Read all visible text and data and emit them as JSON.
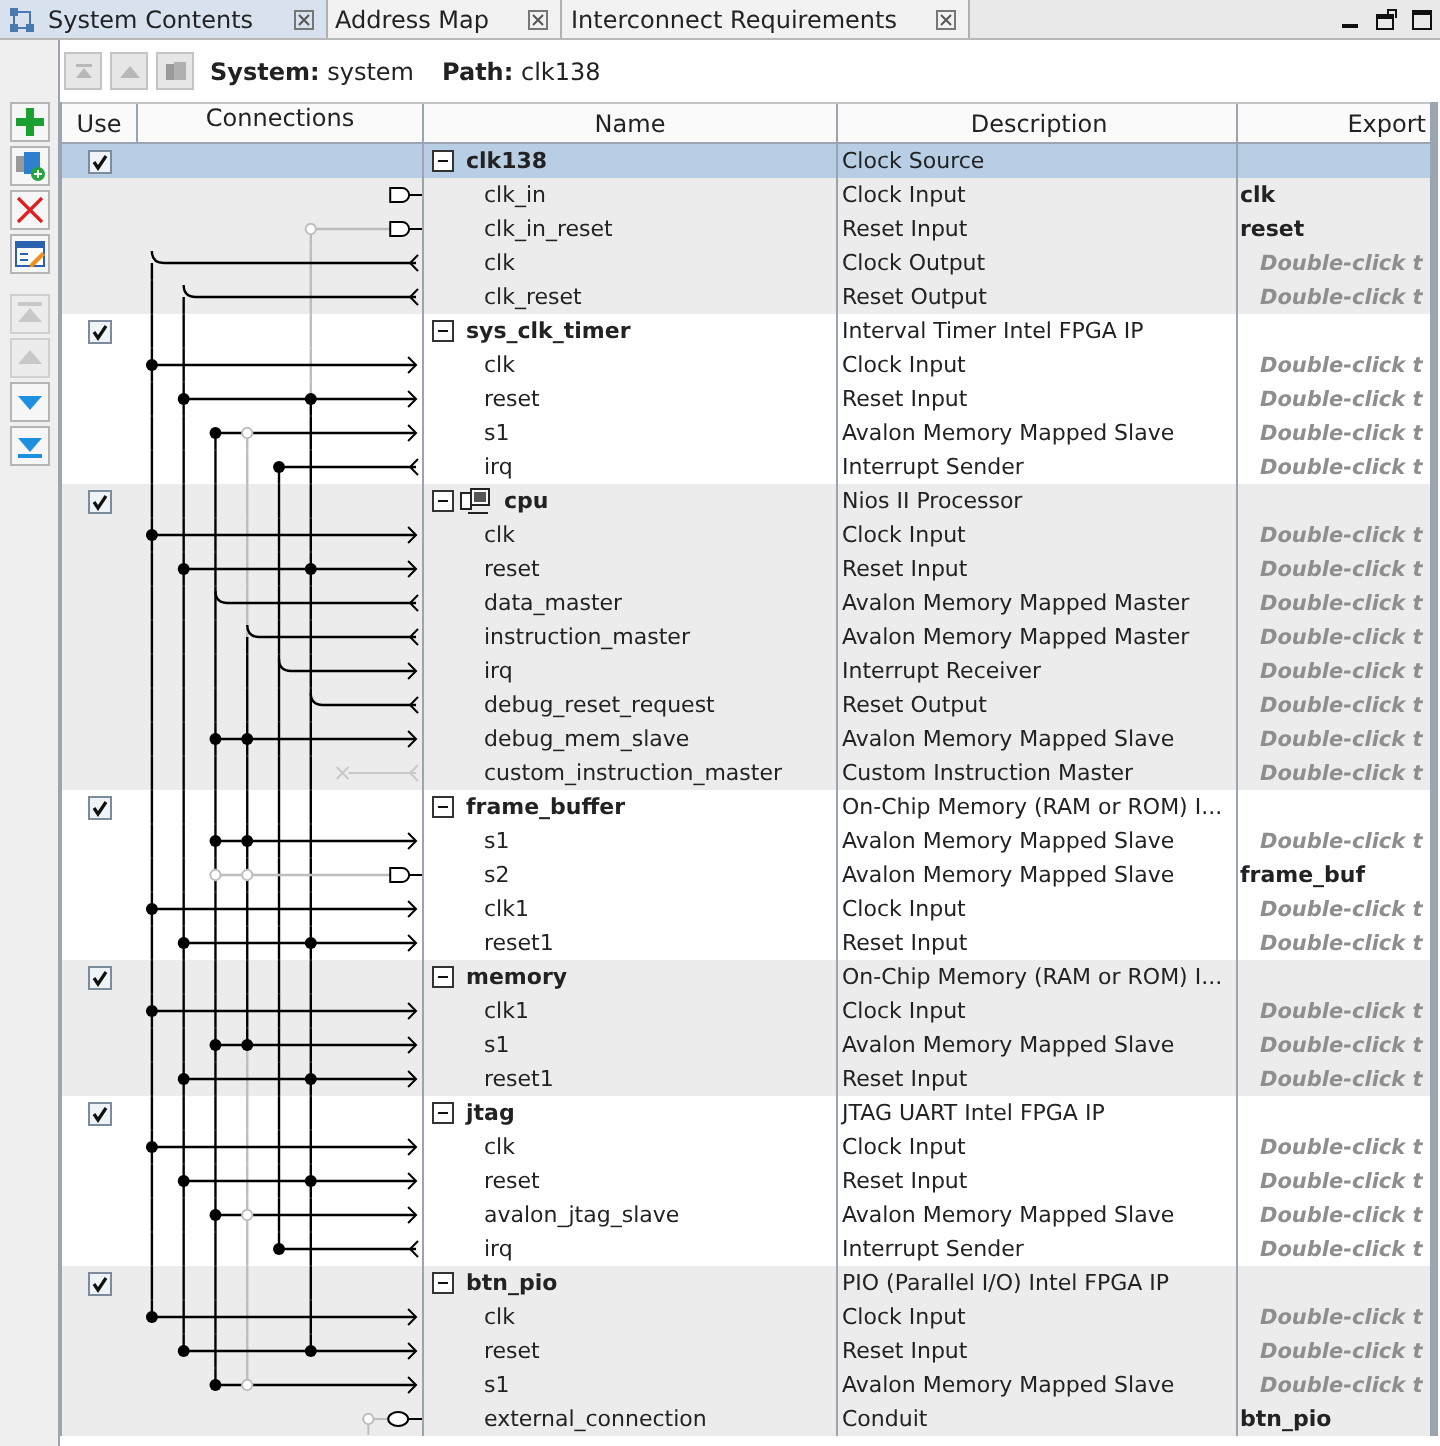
{
  "tabs": [
    {
      "label": "System Contents",
      "selected": true
    },
    {
      "label": "Address Map",
      "selected": false
    },
    {
      "label": "Interconnect Requirements",
      "selected": false
    }
  ],
  "nav_buttons": [
    {
      "kind": "top",
      "disabled": true
    },
    {
      "kind": "up",
      "disabled": true
    },
    {
      "kind": "hierarchy",
      "disabled": true
    }
  ],
  "system": "**System:** system",
  "path": "**Path:** clk138",
  "tools": [
    {
      "kind": "add",
      "disabled": false
    },
    {
      "kind": "new-component",
      "disabled": false
    },
    {
      "kind": "remove",
      "disabled": false
    },
    {
      "kind": "edit",
      "disabled": false
    },
    {
      "kind": "move-top",
      "disabled": true
    },
    {
      "kind": "move-up",
      "disabled": true
    },
    {
      "kind": "move-down",
      "disabled": false
    },
    {
      "kind": "move-bottom",
      "disabled": false
    }
  ],
  "table": {
    "columns": [
      "Use",
      "Connections",
      "Name",
      "Description",
      "Export"
    ],
    "components": [
      {
        "name": "clk138",
        "description": "Clock Source",
        "use": true,
        "expanded": true,
        "selected": true,
        "interfaces": [
          {
            "name": "clk_in",
            "description": "Clock Input",
            "export": {
              "kind": "name",
              "text": "clk"
            }
          },
          {
            "name": "clk_in_reset",
            "description": "Reset Input",
            "export": {
              "kind": "name",
              "text": "reset"
            }
          },
          {
            "name": "clk",
            "description": "Clock Output",
            "export": {
              "kind": "hint",
              "text": "Double-click t"
            }
          },
          {
            "name": "clk_reset",
            "description": "Reset Output",
            "export": {
              "kind": "hint",
              "text": "Double-click t"
            }
          }
        ]
      },
      {
        "name": "sys_clk_timer",
        "description": "Interval Timer Intel FPGA IP",
        "use": true,
        "expanded": true,
        "selected": false,
        "interfaces": [
          {
            "name": "clk",
            "description": "Clock Input",
            "export": {
              "kind": "hint",
              "text": "Double-click t"
            }
          },
          {
            "name": "reset",
            "description": "Reset Input",
            "export": {
              "kind": "hint",
              "text": "Double-click t"
            }
          },
          {
            "name": "s1",
            "description": "Avalon Memory Mapped Slave",
            "export": {
              "kind": "hint",
              "text": "Double-click t"
            }
          },
          {
            "name": "irq",
            "description": "Interrupt Sender",
            "export": {
              "kind": "hint",
              "text": "Double-click t"
            }
          }
        ]
      },
      {
        "name": "cpu",
        "description": "Nios II Processor",
        "use": true,
        "expanded": true,
        "selected": false,
        "kind": "processor",
        "interfaces": [
          {
            "name": "clk",
            "description": "Clock Input",
            "export": {
              "kind": "hint",
              "text": "Double-click t"
            }
          },
          {
            "name": "reset",
            "description": "Reset Input",
            "export": {
              "kind": "hint",
              "text": "Double-click t"
            }
          },
          {
            "name": "data_master",
            "description": "Avalon Memory Mapped Master",
            "export": {
              "kind": "hint",
              "text": "Double-click t"
            }
          },
          {
            "name": "instruction_master",
            "description": "Avalon Memory Mapped Master",
            "export": {
              "kind": "hint",
              "text": "Double-click t"
            }
          },
          {
            "name": "irq",
            "description": "Interrupt Receiver",
            "export": {
              "kind": "hint",
              "text": "Double-click t"
            }
          },
          {
            "name": "debug_reset_request",
            "description": "Reset Output",
            "export": {
              "kind": "hint",
              "text": "Double-click t"
            }
          },
          {
            "name": "debug_mem_slave",
            "description": "Avalon Memory Mapped Slave",
            "export": {
              "kind": "hint",
              "text": "Double-click t"
            }
          },
          {
            "name": "custom_instruction_master",
            "description": "Custom Instruction Master",
            "export": {
              "kind": "hint",
              "text": "Double-click t"
            }
          }
        ]
      },
      {
        "name": "frame_buffer",
        "description": "On-Chip Memory (RAM or ROM) I...",
        "use": true,
        "expanded": true,
        "selected": false,
        "interfaces": [
          {
            "name": "s1",
            "description": "Avalon Memory Mapped Slave",
            "export": {
              "kind": "hint",
              "text": "Double-click t"
            }
          },
          {
            "name": "s2",
            "description": "Avalon Memory Mapped Slave",
            "export": {
              "kind": "name",
              "text": "frame_buf"
            }
          },
          {
            "name": "clk1",
            "description": "Clock Input",
            "export": {
              "kind": "hint",
              "text": "Double-click t"
            }
          },
          {
            "name": "reset1",
            "description": "Reset Input",
            "export": {
              "kind": "hint",
              "text": "Double-click t"
            }
          }
        ]
      },
      {
        "name": "memory",
        "description": "On-Chip Memory (RAM or ROM) I...",
        "use": true,
        "expanded": true,
        "selected": false,
        "interfaces": [
          {
            "name": "clk1",
            "description": "Clock Input",
            "export": {
              "kind": "hint",
              "text": "Double-click t"
            }
          },
          {
            "name": "s1",
            "description": "Avalon Memory Mapped Slave",
            "export": {
              "kind": "hint",
              "text": "Double-click t"
            }
          },
          {
            "name": "reset1",
            "description": "Reset Input",
            "export": {
              "kind": "hint",
              "text": "Double-click t"
            }
          }
        ]
      },
      {
        "name": "jtag",
        "description": "JTAG UART Intel FPGA IP",
        "use": true,
        "expanded": true,
        "selected": false,
        "interfaces": [
          {
            "name": "clk",
            "description": "Clock Input",
            "export": {
              "kind": "hint",
              "text": "Double-click t"
            }
          },
          {
            "name": "reset",
            "description": "Reset Input",
            "export": {
              "kind": "hint",
              "text": "Double-click t"
            }
          },
          {
            "name": "avalon_jtag_slave",
            "description": "Avalon Memory Mapped Slave",
            "export": {
              "kind": "hint",
              "text": "Double-click t"
            }
          },
          {
            "name": "irq",
            "description": "Interrupt Sender",
            "export": {
              "kind": "hint",
              "text": "Double-click t"
            }
          }
        ]
      },
      {
        "name": "btn_pio",
        "description": "PIO (Parallel I/O) Intel FPGA IP",
        "use": true,
        "expanded": true,
        "selected": false,
        "interfaces": [
          {
            "name": "clk",
            "description": "Clock Input",
            "export": {
              "kind": "hint",
              "text": "Double-click t"
            }
          },
          {
            "name": "reset",
            "description": "Reset Input",
            "export": {
              "kind": "hint",
              "text": "Double-click t"
            }
          },
          {
            "name": "s1",
            "description": "Avalon Memory Mapped Slave",
            "export": {
              "kind": "hint",
              "text": "Double-click t"
            }
          },
          {
            "name": "external_connection",
            "description": "Conduit",
            "export": {
              "kind": "name",
              "text": "btn_pio"
            }
          }
        ]
      }
    ]
  }
}
